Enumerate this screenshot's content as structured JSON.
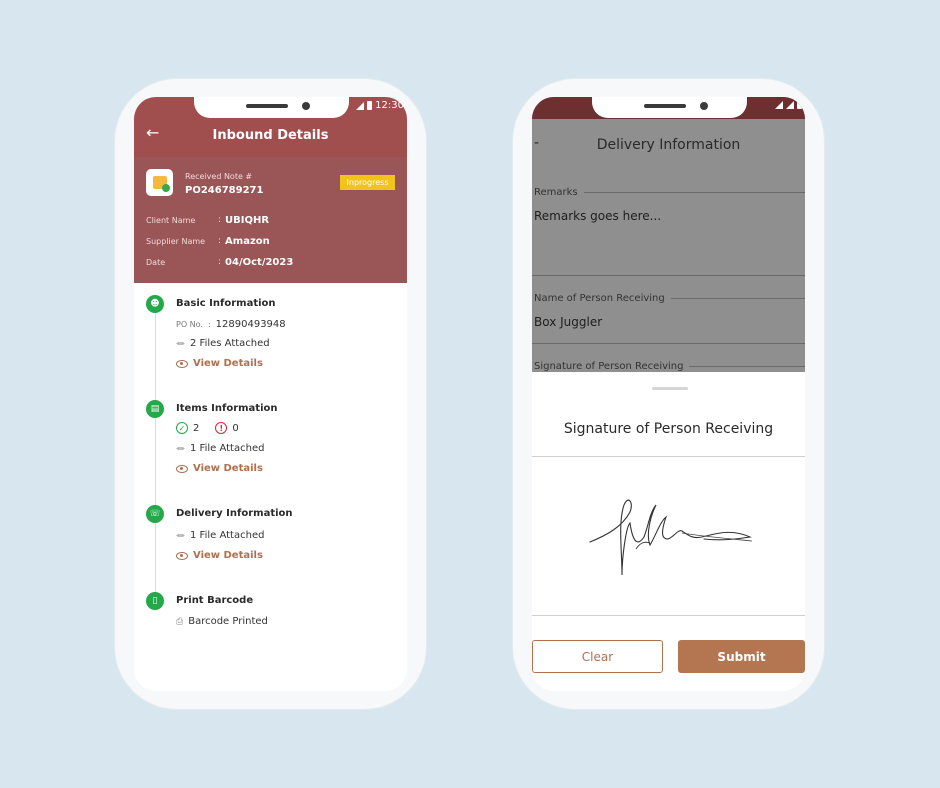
{
  "left_phone": {
    "status_time": "12:30",
    "header": {
      "title": "Inbound Details"
    },
    "summary": {
      "received_note_label": "Received Note #",
      "received_note_value": "PO246789271",
      "status_badge": "Inprogress",
      "rows": [
        {
          "label": "Client Name",
          "value": "UBIQHR"
        },
        {
          "label": "Supplier Name",
          "value": "Amazon"
        },
        {
          "label": "Date",
          "value": "04/Oct/2023"
        }
      ]
    },
    "steps": {
      "basic": {
        "title": "Basic Information",
        "po_label": "PO No.",
        "po_value": "12890493948",
        "attachments": "2 Files Attached",
        "view_label": "View Details"
      },
      "items": {
        "title": "Items Information",
        "ok_count": "2",
        "error_count": "0",
        "attachments": "1 File Attached",
        "view_label": "View Details"
      },
      "delivery": {
        "title": "Delivery Information",
        "attachments": "1 File Attached",
        "view_label": "View Details"
      },
      "barcode": {
        "title": "Print Barcode",
        "status": "Barcode Printed"
      }
    },
    "colors": {
      "header": "#a04e4e",
      "accent": "#b0704e",
      "success": "#23a84a",
      "badge": "#f2c318"
    }
  },
  "right_phone": {
    "header": {
      "title": "Delivery Information"
    },
    "fields": {
      "remarks_label": "Remarks",
      "remarks_value": "Remarks goes here...",
      "receiver_label": "Name of Person Receiving",
      "receiver_value": "Box Juggler",
      "signature_label": "Signature of Person Receiving"
    },
    "sheet": {
      "title": "Signature of Person Receiving",
      "clear_label": "Clear",
      "submit_label": "Submit"
    }
  }
}
